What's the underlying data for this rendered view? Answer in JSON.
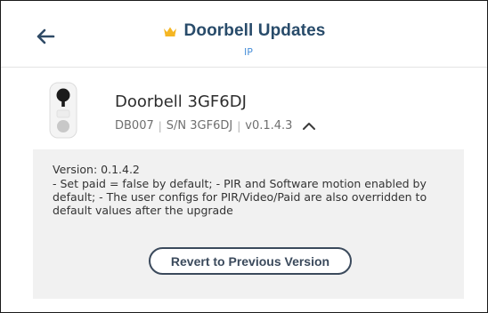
{
  "header": {
    "title": "Doorbell Updates",
    "subtitle": "IP",
    "back_icon": "arrow-left-icon",
    "title_icon": "crown-icon",
    "accent_color": "#f5b623"
  },
  "device": {
    "name": "Doorbell 3GF6DJ",
    "model": "DB007",
    "serial": "S/N 3GF6DJ",
    "firmware": "v0.1.4.3",
    "separator": "|",
    "toggle_icon": "chevron-up-icon"
  },
  "release": {
    "version": "Version: 0.1.4.2",
    "notes": " - Set paid = false by default; - PIR and Software motion enabled by default; - The user configs for PIR/Video/Paid are also overridden to default values after the upgrade",
    "revert_label": "Revert to Previous Version"
  }
}
